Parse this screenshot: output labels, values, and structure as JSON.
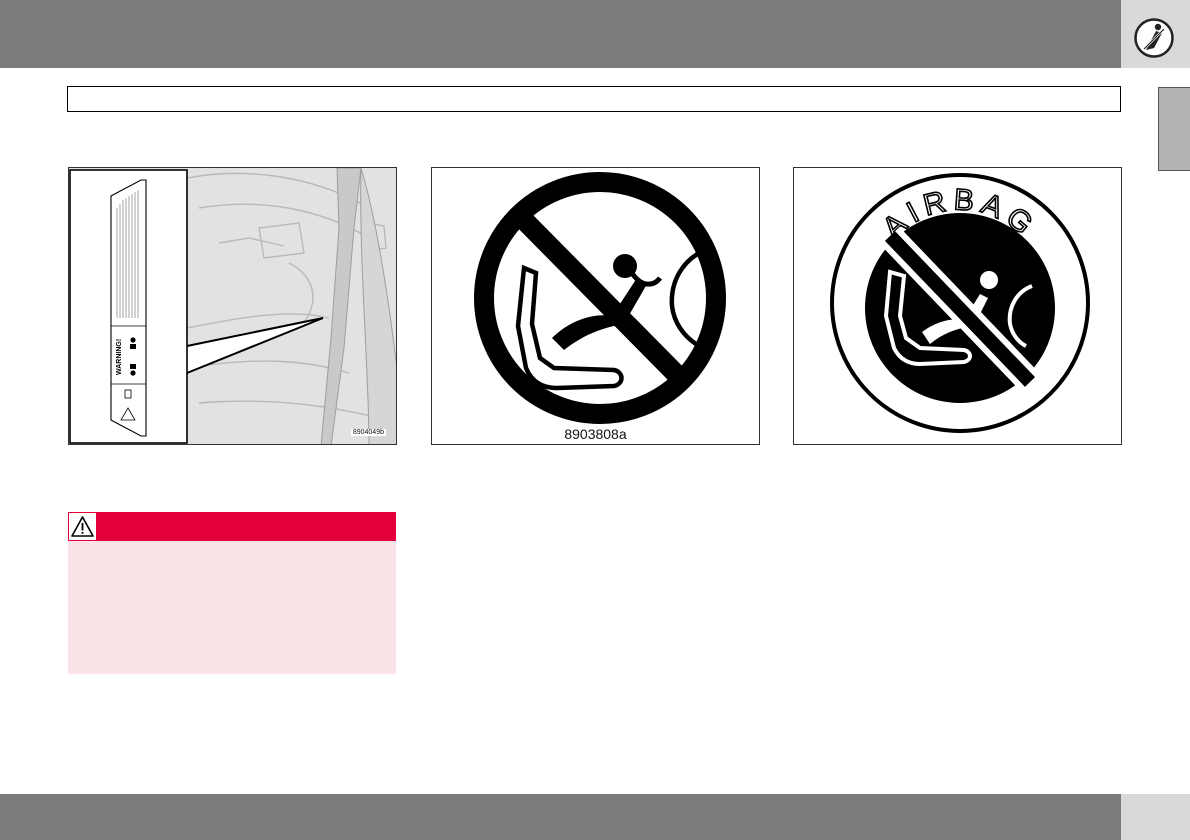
{
  "figures": {
    "fig1_code": "8904049b",
    "fig2_code": "8903808a",
    "fig3_label": "AIRBAG"
  },
  "label_sticker": {
    "heading": "WARNING!"
  },
  "icons": {
    "chapter_icon": "seatbelt-occupant-icon",
    "warning_icon": "warning-triangle-icon"
  },
  "colors": {
    "header_bar": "#7b7b7b",
    "warning_red": "#e4003a",
    "warning_pink": "#fbe3e8"
  }
}
